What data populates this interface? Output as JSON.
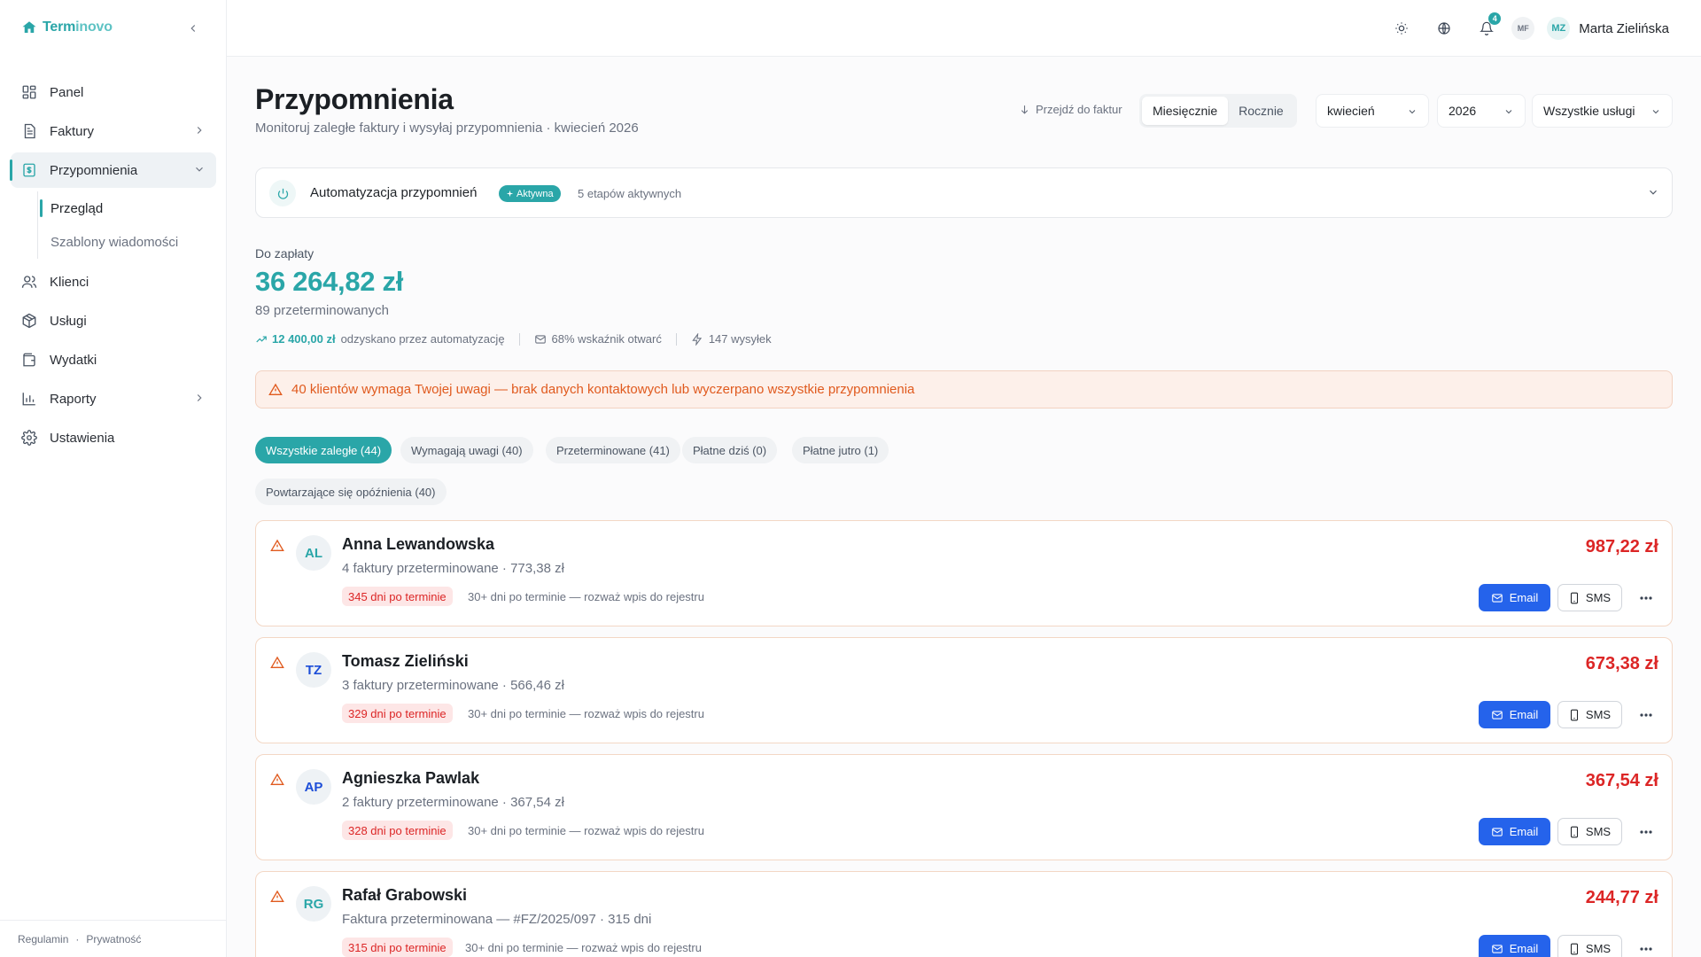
{
  "brand": {
    "name_part1": "Term",
    "name_part2": "inovo"
  },
  "sidebar": {
    "items": [
      {
        "label": "Panel",
        "icon": "grid-icon"
      },
      {
        "label": "Faktury",
        "icon": "document-icon"
      },
      {
        "label": "Przypomnienia",
        "icon": "receipt-icon"
      },
      {
        "label": "Klienci",
        "icon": "users-icon"
      },
      {
        "label": "Usługi",
        "icon": "box-icon"
      },
      {
        "label": "Wydatki",
        "icon": "wallet-icon"
      },
      {
        "label": "Raporty",
        "icon": "chart-icon"
      },
      {
        "label": "Ustawienia",
        "icon": "gear-icon"
      }
    ],
    "subitems": [
      {
        "label": "Przegląd"
      },
      {
        "label": "Szablony wiadomości"
      }
    ],
    "footer": {
      "terms": "Regulamin",
      "dot": "·",
      "privacy": "Prywatność"
    }
  },
  "topbar": {
    "notifications_count": "4",
    "mini_avatar": "MF",
    "user_initials": "MZ",
    "user_name": "Marta Zielińska"
  },
  "header": {
    "title": "Przypomnienia",
    "subtitle": "Monitoruj zaległe faktury i wysyłaj przypomnienia · kwiecień 2026",
    "goto_invoices": "Przejdź do faktur",
    "period_tabs": [
      "Miesięcznie",
      "Rocznie"
    ],
    "period_active": "Miesięcznie",
    "month": "kwiecień",
    "year": "2026",
    "services": "Wszystkie usługi"
  },
  "automation": {
    "title": "Automatyzacja przypomnień",
    "status": "Aktywna",
    "steps": "5 etapów aktywnych"
  },
  "summary": {
    "label": "Do zapłaty",
    "amount": "36 264,82 zł",
    "overdue_count": "89 przeterminowanych",
    "recovered_amount": "12 400,00 zł",
    "recovered_label": "odzyskano przez automatyzację",
    "open_rate": "68% wskaźnik otwarć",
    "sent": "147 wysyłek"
  },
  "alert": {
    "text": "40 klientów wymaga Twojej uwagi — brak danych kontaktowych lub wyczerpano wszystkie przypomnienia"
  },
  "filters": [
    {
      "label": "Wszystkie zaległe (44)",
      "active": true
    },
    {
      "label": "Wymagają uwagi (40)",
      "active": false
    },
    {
      "label": "Przeterminowane (41)",
      "active": false
    },
    {
      "label": "Płatne dziś (0)",
      "active": false
    },
    {
      "label": "Płatne jutro (1)",
      "active": false
    },
    {
      "label": "Powtarzające się opóźnienia (40)",
      "active": false
    }
  ],
  "clients": [
    {
      "initials": "AL",
      "name": "Anna Lewandowska",
      "sub": "4 faktury przeterminowane · 773,38 zł",
      "badge": "345 dni po terminie",
      "note": "30+ dni po terminie — rozważ wpis do rejestru",
      "amount": "987,22 zł",
      "avatar_color": "#2aa6a8"
    },
    {
      "initials": "TZ",
      "name": "Tomasz Zieliński",
      "sub": "3 faktury przeterminowane · 566,46 zł",
      "badge": "329 dni po terminie",
      "note": "30+ dni po terminie — rozważ wpis do rejestru",
      "amount": "673,38 zł",
      "avatar_color": "#1d4ed8"
    },
    {
      "initials": "AP",
      "name": "Agnieszka Pawlak",
      "sub": "2 faktury przeterminowane · 367,54 zł",
      "badge": "328 dni po terminie",
      "note": "30+ dni po terminie — rozważ wpis do rejestru",
      "amount": "367,54 zł",
      "avatar_color": "#1d4ed8"
    },
    {
      "initials": "RG",
      "name": "Rafał Grabowski",
      "sub": "Faktura przeterminowana — #FZ/2025/097 · 315 dni",
      "badge": "315 dni po terminie",
      "note": "30+ dni po terminie — rozważ wpis do rejestru",
      "amount": "244,77 zł",
      "avatar_color": "#2aa6a8"
    }
  ],
  "actions": {
    "email": "Email",
    "sms": "SMS"
  },
  "colors": {
    "accent": "#2aa6a8",
    "danger": "#dc2626",
    "warning": "#e05a1e",
    "primary_button": "#2563eb"
  }
}
